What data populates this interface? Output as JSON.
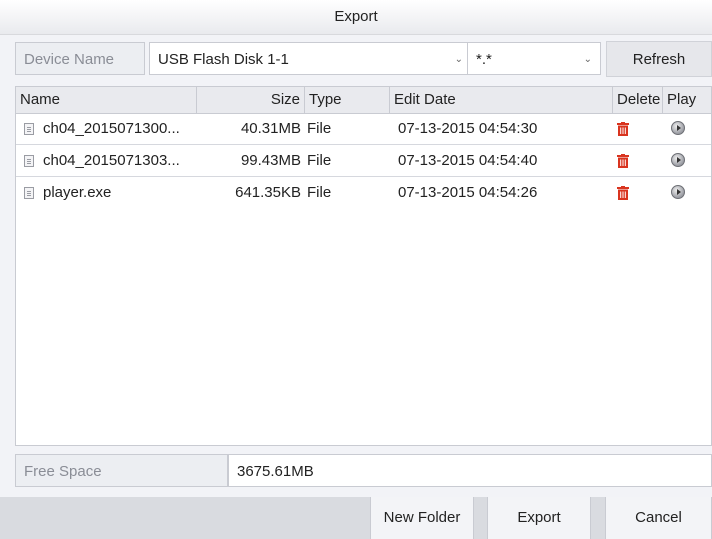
{
  "window": {
    "title": "Export"
  },
  "device": {
    "label": "Device Name",
    "value": "USB Flash Disk 1-1",
    "filter": "*.*",
    "refresh_label": "Refresh"
  },
  "table": {
    "headers": {
      "name": "Name",
      "size": "Size",
      "type": "Type",
      "edit_date": "Edit Date",
      "delete": "Delete",
      "play": "Play"
    },
    "rows": [
      {
        "name": "ch04_2015071300...",
        "size": "40.31MB",
        "type": "File",
        "edit_date": "07-13-2015 04:54:30"
      },
      {
        "name": "ch04_2015071303...",
        "size": "99.43MB",
        "type": "File",
        "edit_date": "07-13-2015 04:54:40"
      },
      {
        "name": "player.exe",
        "size": "641.35KB",
        "type": "File",
        "edit_date": "07-13-2015 04:54:26"
      }
    ]
  },
  "free_space": {
    "label": "Free Space",
    "value": "3675.61MB"
  },
  "buttons": {
    "new_folder": "New Folder",
    "export": "Export",
    "cancel": "Cancel"
  },
  "colors": {
    "delete_icon": "#d9341f",
    "accent_border": "#c9cbd2"
  },
  "icons": {
    "file": "file-icon",
    "delete": "trash-icon",
    "play": "play-icon"
  }
}
